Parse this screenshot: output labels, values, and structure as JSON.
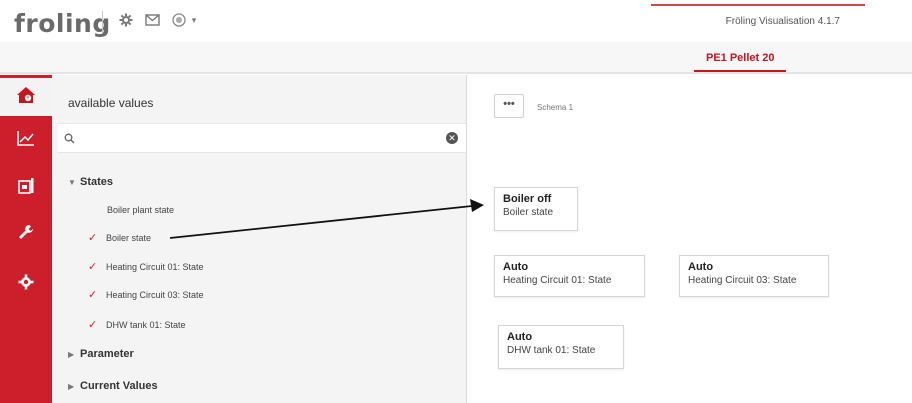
{
  "header": {
    "logo": "froling",
    "version": "Fröling Visualisation 4.1.7",
    "device_tab": "PE1 Pellet 20",
    "icons": [
      "gear-icon",
      "mail-icon",
      "status-icon",
      "chevron-down-icon"
    ]
  },
  "nav": {
    "items": [
      {
        "icon": "home-icon",
        "active": true
      },
      {
        "icon": "chart-icon",
        "active": false
      },
      {
        "icon": "boiler-icon",
        "active": false
      },
      {
        "icon": "wrench-icon",
        "active": false
      },
      {
        "icon": "gear-icon",
        "active": false
      }
    ]
  },
  "panel": {
    "title": "available values",
    "search": {
      "value": "",
      "placeholder": ""
    },
    "groups": [
      {
        "label": "States",
        "expanded": true,
        "items": [
          {
            "label": "Boiler plant state",
            "checked": false
          },
          {
            "label": "Boiler state",
            "checked": true
          },
          {
            "label": "Heating Circuit 01: State",
            "checked": true
          },
          {
            "label": "Heating Circuit 03: State",
            "checked": true
          },
          {
            "label": "DHW tank 01: State",
            "checked": true
          }
        ]
      },
      {
        "label": "Parameter",
        "expanded": false
      },
      {
        "label": "Current Values",
        "expanded": false
      }
    ]
  },
  "canvas": {
    "more_label": "•••",
    "schema_label": "Schema 1",
    "tiles": [
      {
        "value": "Boiler off",
        "label": "Boiler state"
      },
      {
        "value": "Auto",
        "label": "Heating Circuit 01: State"
      },
      {
        "value": "Auto",
        "label": "Heating Circuit 03: State"
      },
      {
        "value": "Auto",
        "label": "DHW tank 01: State"
      }
    ]
  },
  "colors": {
    "brand_red": "#cc1f2b",
    "accent_red": "#c7141e",
    "check_red": "#d6242e"
  }
}
